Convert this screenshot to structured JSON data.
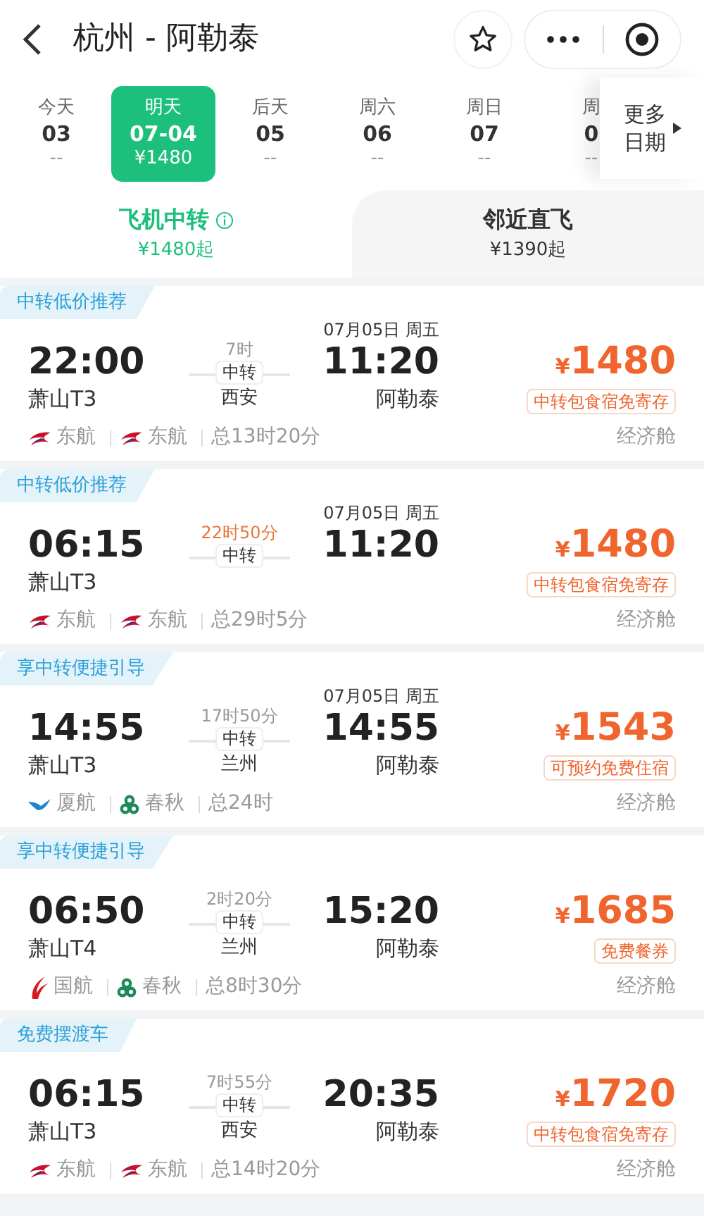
{
  "header": {
    "title": "杭州 - 阿勒泰"
  },
  "dates": [
    {
      "label": "今天",
      "date": "03",
      "price": "--",
      "selected": false
    },
    {
      "label": "明天",
      "date": "07-04",
      "price": "¥1480",
      "selected": true
    },
    {
      "label": "后天",
      "date": "05",
      "price": "--",
      "selected": false
    },
    {
      "label": "周六",
      "date": "06",
      "price": "--",
      "selected": false
    },
    {
      "label": "周日",
      "date": "07",
      "price": "--",
      "selected": false
    },
    {
      "label": "周",
      "date": "0",
      "price": "--",
      "selected": false
    }
  ],
  "more_dates": "更多日期",
  "modes": [
    {
      "title": "飞机中转",
      "price": "¥1480起",
      "info": true,
      "selected": true
    },
    {
      "title": "邻近直飞",
      "price": "¥1390起",
      "info": false,
      "selected": false
    }
  ],
  "flights": [
    {
      "tag": "中转低价推荐",
      "dep_time": "22:00",
      "dep_airport": "萧山T3",
      "duration": "7时",
      "duration_warn": false,
      "via": "中转",
      "via_city": "西安",
      "arr_date": "07月05日 周五",
      "arr_time": "11:20",
      "arr_airport": "阿勒泰",
      "price_symbol": "¥",
      "price": "1480",
      "perk": "中转包食宿免寄存",
      "airlines": [
        {
          "name": "东航",
          "kind": "swallow"
        },
        {
          "name": "东航",
          "kind": "swallow"
        }
      ],
      "total": "总13时20分",
      "cabin": "经济舱"
    },
    {
      "tag": "中转低价推荐",
      "dep_time": "06:15",
      "dep_airport": "萧山T3",
      "duration": "22时50分",
      "duration_warn": true,
      "via": "中转",
      "arr_date": "07月05日 周五",
      "arr_time": "11:20",
      "price_symbol": "¥",
      "price": "1480",
      "perk": "中转包食宿免寄存",
      "airlines": [
        {
          "name": "东航",
          "kind": "swallow"
        },
        {
          "name": "东航",
          "kind": "swallow"
        }
      ],
      "total": "总29时5分",
      "cabin": "经济舱"
    },
    {
      "tag": "享中转便捷引导",
      "dep_time": "14:55",
      "dep_airport": "萧山T3",
      "duration": "17时50分",
      "duration_warn": false,
      "via": "中转",
      "via_city": "兰州",
      "arr_date": "07月05日 周五",
      "arr_time": "14:55",
      "arr_airport": "阿勒泰",
      "price_symbol": "¥",
      "price": "1543",
      "perk": "可预约免费住宿",
      "airlines": [
        {
          "name": "厦航",
          "kind": "bird"
        },
        {
          "name": "春秋",
          "kind": "trefoil"
        }
      ],
      "total": "总24时",
      "cabin": "经济舱"
    },
    {
      "tag": "享中转便捷引导",
      "dep_time": "06:50",
      "dep_airport": "萧山T4",
      "duration": "2时20分",
      "duration_warn": false,
      "via": "中转",
      "via_city": "兰州",
      "arr_time": "15:20",
      "arr_airport": "阿勒泰",
      "price_symbol": "¥",
      "price": "1685",
      "perk": "免费餐券",
      "airlines": [
        {
          "name": "国航",
          "kind": "phoenix"
        },
        {
          "name": "春秋",
          "kind": "trefoil"
        }
      ],
      "total": "总8时30分",
      "cabin": "经济舱"
    },
    {
      "tag": "免费摆渡车",
      "dep_time": "06:15",
      "dep_airport": "萧山T3",
      "duration": "7时55分",
      "duration_warn": false,
      "via": "中转",
      "via_city": "西安",
      "arr_time": "20:35",
      "arr_airport": "阿勒泰",
      "price_symbol": "¥",
      "price": "1720",
      "perk": "中转包食宿免寄存",
      "airlines": [
        {
          "name": "东航",
          "kind": "swallow"
        },
        {
          "name": "东航",
          "kind": "swallow"
        }
      ],
      "total": "总14时20分",
      "cabin": "经济舱"
    }
  ]
}
